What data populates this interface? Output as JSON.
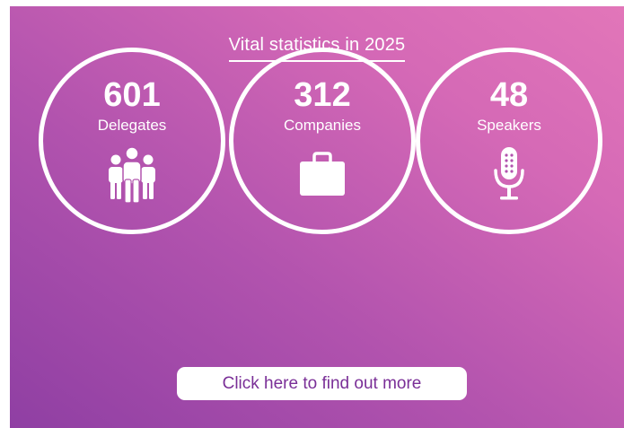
{
  "heading": "Vital statistics in 2025",
  "stats": [
    {
      "number": "601",
      "label": "Delegates",
      "icon": "people-group-icon"
    },
    {
      "number": "312",
      "label": "Companies",
      "icon": "briefcase-icon"
    },
    {
      "number": "48",
      "label": "Speakers",
      "icon": "microphone-icon"
    }
  ],
  "cta_label": "Click here to find out more",
  "colors": {
    "gradient_start": "#8f3fa3",
    "gradient_end": "#e276b9",
    "text": "#ffffff",
    "cta_text": "#7a2f97",
    "cta_background": "#ffffff"
  }
}
